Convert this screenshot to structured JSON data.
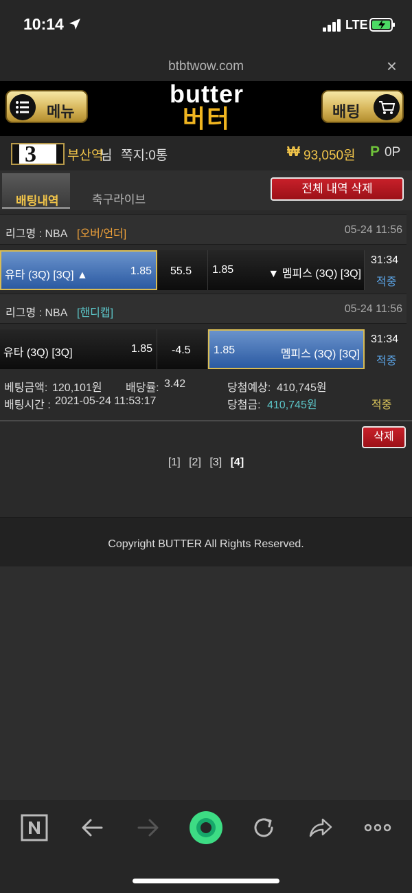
{
  "status": {
    "time": "10:14",
    "network": "LTE"
  },
  "browser": {
    "url": "btbtwow.com",
    "close_label": "×"
  },
  "header": {
    "menu_label": "메뉴",
    "bet_label": "배팅",
    "logo_en": "butter",
    "logo_ko": "버터"
  },
  "user": {
    "level": "3",
    "name": "부산역",
    "name_suffix": "님",
    "messages": "쪽지:0통",
    "won_symbol": "₩",
    "money": "93,050원",
    "p_symbol": "P",
    "points": "0P"
  },
  "tabs": {
    "active": "배팅내역",
    "second": "축구라이브",
    "delete_all": "전체 내역 삭제"
  },
  "bets": [
    {
      "league_label": "리그명 : NBA",
      "league_type": "[오버/언더]",
      "league_type_color": "#f0a23a",
      "date": "05-24 11:56",
      "home": "유타 (3Q) [3Q] ▲",
      "home_odds": "1.85",
      "center": "55.5",
      "away_odds": "1.85",
      "away": "▼ 멤피스 (3Q) [3Q]",
      "selected": "home",
      "time": "31:34",
      "status": "적중"
    },
    {
      "league_label": "리그명 : NBA",
      "league_type": "[핸디캡]",
      "league_type_color": "#5cc6c9",
      "date": "05-24 11:56",
      "home": "유타 (3Q) [3Q]",
      "home_odds": "1.85",
      "center": "-4.5",
      "away_odds": "1.85",
      "away": "멤피스 (3Q) [3Q]",
      "selected": "away",
      "time": "31:34",
      "status": "적중"
    }
  ],
  "summary": {
    "bet_amount_label": "베팅금액:",
    "bet_amount": "120,101원",
    "rate_label": "배당률:",
    "rate": "3.42",
    "expected_label": "당첨예상:",
    "expected": "410,745원",
    "time_label": "배팅시간 :",
    "time": "2021-05-24 11:53:17",
    "win_label": "당첨금:",
    "win": "410,745원",
    "result": "적중"
  },
  "actions": {
    "delete": "삭제"
  },
  "pagination": [
    "[1]",
    "[2]",
    "[3]",
    "[4]"
  ],
  "pagination_current": "[4]",
  "footer": "Copyright BUTTER All Rights Reserved.",
  "colors": {
    "gold": "#f2c54a",
    "red_button": "#b3161f",
    "selected_blue": "#3f6fb5"
  }
}
